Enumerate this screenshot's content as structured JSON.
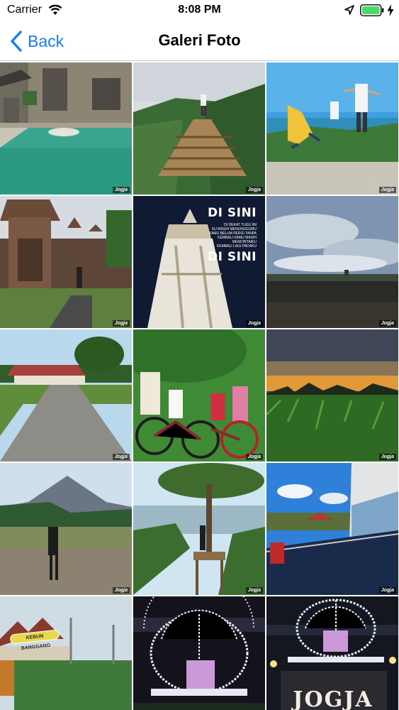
{
  "status_bar": {
    "carrier": "Carrier",
    "time": "8:08 PM",
    "icons": [
      "wifi-icon",
      "location-arrow-icon",
      "battery-icon",
      "charging-bolt-icon"
    ],
    "battery_color": "#4cd964"
  },
  "nav": {
    "back_label": "Back",
    "title": "Galeri Foto",
    "accent": "#147efb"
  },
  "gallery": {
    "watermark": "Jogja",
    "photos": [
      {
        "subject": "palace water pool"
      },
      {
        "subject": "wooden bridge hill"
      },
      {
        "subject": "jumping people lake view"
      },
      {
        "subject": "brick temple gate"
      },
      {
        "subject": "tugu monument",
        "text": {
          "heading1": "DI SINI",
          "heading2": "DI SINI",
          "lines": [
            "DI DEKAT TUGU INI",
            "KU MASIH MENUNGGUMU",
            "KAMU BELUM PERGI TANPA",
            "KEMBALI KAMU MASIH",
            "MENCINTAIKU",
            "KEMBALI LAGI PADAKU"
          ]
        }
      },
      {
        "subject": "cloudy sky field"
      },
      {
        "subject": "keraton road pavilion"
      },
      {
        "subject": "kids with bicycles"
      },
      {
        "subject": "sunset rice field"
      },
      {
        "subject": "merapi volcano walker"
      },
      {
        "subject": "pine tree lookout"
      },
      {
        "subject": "mall balcony view"
      },
      {
        "subject": "kebun banggang sign",
        "sign": "KEBUN BANGGANG"
      },
      {
        "subject": "lit carriage night"
      },
      {
        "subject": "lit carriage jogja",
        "sign": "JOGJA"
      }
    ]
  }
}
